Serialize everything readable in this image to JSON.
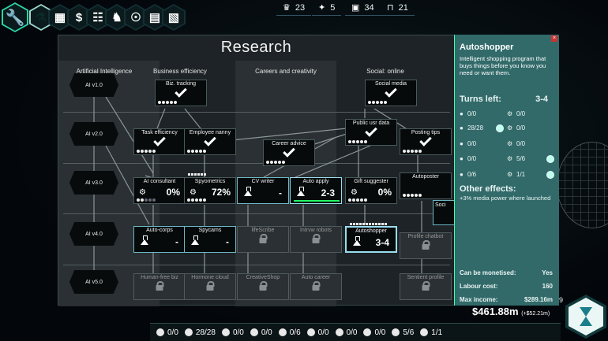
{
  "top_bar": {
    "tabs": [
      {
        "name": "menu-tab",
        "icon": "wrench-icon",
        "glyph": "🔧"
      },
      {
        "name": "research-tab",
        "icon": "flask-icon",
        "glyph": "⚗"
      },
      {
        "name": "organization-tab",
        "icon": "org-chart-icon",
        "glyph": "▦"
      },
      {
        "name": "finance-tab",
        "icon": "dollar-icon",
        "glyph": "$"
      },
      {
        "name": "population-tab",
        "icon": "people-icon",
        "glyph": "☷"
      },
      {
        "name": "strategy-tab",
        "icon": "chess-knight-icon",
        "glyph": "♞"
      },
      {
        "name": "alien-tab",
        "icon": "ufo-icon",
        "glyph": "☉"
      },
      {
        "name": "report-tab",
        "icon": "report-icon",
        "glyph": "▤"
      },
      {
        "name": "documents-tab",
        "icon": "document-icon",
        "glyph": "▧"
      }
    ],
    "resources": [
      {
        "name": "influence-stat",
        "icon": "award-icon",
        "value": "23"
      },
      {
        "name": "security-stat",
        "icon": "eagle-icon",
        "value": "5"
      },
      {
        "name": "presentation-stat",
        "icon": "presentation-icon",
        "value": "34"
      },
      {
        "name": "workers-stat",
        "icon": "person-frame-icon",
        "value": "21"
      }
    ]
  },
  "research": {
    "title": "Research",
    "columns": [
      "Artificial Intelligence",
      "Business efficiency",
      "Careers and creativity",
      "Social: online"
    ],
    "ai_levels": [
      "AI v1.0",
      "AI v2.0",
      "AI v3.0",
      "AI v4.0",
      "AI v5.0"
    ],
    "nodes": {
      "biz_tracking": {
        "label": "Biz. tracking"
      },
      "social_media": {
        "label": "Social media"
      },
      "task_efficiency": {
        "label": "Task efficiency"
      },
      "employee_nanny": {
        "label": "Employee nanny"
      },
      "career_advice": {
        "label": "Career advice"
      },
      "public_usr_data": {
        "label": "Public usr data"
      },
      "posting_tips": {
        "label": "Posting tips"
      },
      "ai_consultant": {
        "label": "AI consultant",
        "value": "0%"
      },
      "spyometrics": {
        "label": "Spyometrics",
        "value": "72%"
      },
      "cv_writer": {
        "label": "CV writer",
        "value": "-"
      },
      "auto_apply": {
        "label": "Auto apply",
        "value": "2-3"
      },
      "gift_suggester": {
        "label": "Gift suggester",
        "value": "0%"
      },
      "autoposter": {
        "label": "Autoposter"
      },
      "auto_corps": {
        "label": "Auto-corps",
        "value": "-"
      },
      "spycams": {
        "label": "Spycams",
        "value": "-"
      },
      "lifescribe": {
        "label": "lifeScribe"
      },
      "intrvw_robots": {
        "label": "Intrvw robots"
      },
      "autoshopper": {
        "label": "Autoshopper",
        "value": "3-4"
      },
      "profile_chatbot": {
        "label": "Profile chatbot"
      },
      "human_free_biz": {
        "label": "Human-free biz"
      },
      "hormone_cloud": {
        "label": "Hormone cloud"
      },
      "creativeshop": {
        "label": "CreativeShop"
      },
      "auto_career": {
        "label": "Auto career"
      },
      "sentient_profile": {
        "label": "Sentient profile"
      }
    },
    "peek_label": "Soci"
  },
  "info": {
    "title": "Autoshopper",
    "description": "Intelligent shopping program that buys things before you know you need or want them.",
    "turns_label": "Turns left:",
    "turns_value": "3-4",
    "staff": [
      {
        "left": "0/0",
        "right": "0/0"
      },
      {
        "left": "28/28",
        "right": "0/0"
      },
      {
        "left": "0/0",
        "right": "0/0"
      },
      {
        "left": "0/0",
        "right": "5/6"
      },
      {
        "left": "0/6",
        "right": "1/1"
      }
    ],
    "other_title": "Other effects:",
    "other_desc": "+3% media power where launched",
    "monetised_label": "Can be monetised:",
    "monetised_value": "Yes",
    "labour_label": "Labour cost:",
    "labour_value": "160",
    "income_label": "Max income:",
    "income_value": "$289.16m",
    "edge_value": "9"
  },
  "money": {
    "value": "$461.88m",
    "delta": "(+$52.21m)"
  },
  "bottom_bar": [
    "0/0",
    "28/28",
    "0/0",
    "0/0",
    "0/6",
    "0/0",
    "0/0",
    "0/0",
    "5/6",
    "1/1"
  ]
}
